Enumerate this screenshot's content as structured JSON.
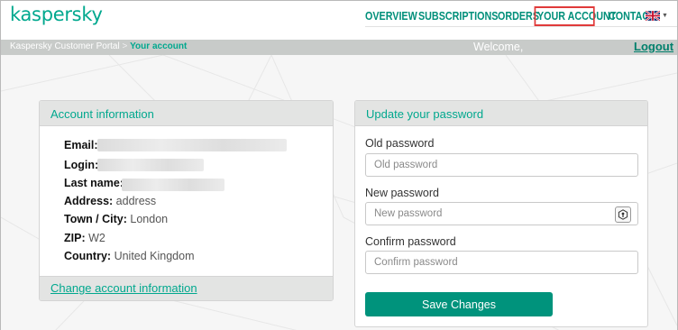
{
  "brand": {
    "logo_text": "kaspersky",
    "accent": "#00a88e"
  },
  "nav": {
    "items": [
      {
        "label": "OVERVIEW"
      },
      {
        "label": "SUBSCRIPTIONS"
      },
      {
        "label": "ORDERS"
      },
      {
        "label": "YOUR ACCOUNT",
        "active": true
      },
      {
        "label": "CONTACT"
      }
    ],
    "language_icon": "uk-flag-icon"
  },
  "breadcrumb": {
    "root": "Kaspersky Customer Portal",
    "separator": ">",
    "current": "Your account"
  },
  "header": {
    "welcome": "Welcome,",
    "logout": "Logout"
  },
  "account_info": {
    "title": "Account information",
    "rows": {
      "email": {
        "label": "Email:",
        "value": ""
      },
      "login": {
        "label": "Login:",
        "value": ""
      },
      "last_name": {
        "label": "Last name:",
        "value": ""
      },
      "address": {
        "label": "Address:",
        "value": "address"
      },
      "town": {
        "label": "Town / City:",
        "value": "London"
      },
      "zip": {
        "label": "ZIP:",
        "value": "W2"
      },
      "country": {
        "label": "Country:",
        "value": "United Kingdom"
      }
    },
    "change_link": "Change account information"
  },
  "password": {
    "title": "Update your password",
    "old_label": "Old password",
    "old_placeholder": "Old password",
    "new_label": "New password",
    "new_placeholder": "New password",
    "confirm_label": "Confirm password",
    "confirm_placeholder": "Confirm password",
    "save_label": "Save Changes"
  }
}
